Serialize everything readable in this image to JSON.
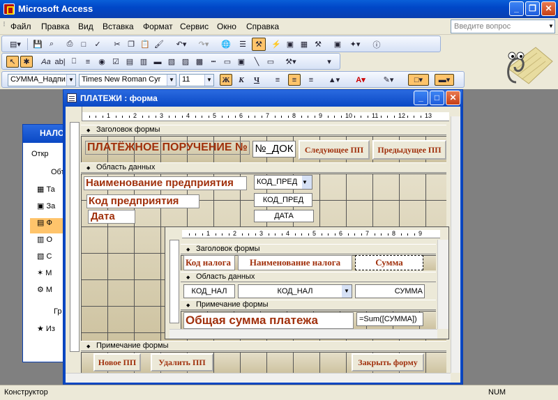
{
  "app": {
    "title": "Microsoft Access"
  },
  "menu": [
    "Файл",
    "Правка",
    "Вид",
    "Вставка",
    "Формат",
    "Сервис",
    "Окно",
    "Справка"
  ],
  "help_box": {
    "placeholder": "Введите вопрос"
  },
  "format_bar": {
    "object": "СУММА_Надпи",
    "font": "Times New Roman Cyr",
    "size": "11"
  },
  "db_window": {
    "title": "НАЛО",
    "open": "Откр",
    "objects_label": "Объ",
    "groups_label": "Гр",
    "items": [
      "Та",
      "За",
      "Ф",
      "О",
      "С",
      "М",
      "М",
      "Из"
    ]
  },
  "form_window": {
    "title": "ПЛАТЕЖИ : форма"
  },
  "ruler_ticks": [
    "1",
    "2",
    "3",
    "4",
    "5",
    "6",
    "7",
    "8",
    "9",
    "10",
    "11",
    "12",
    "13"
  ],
  "subruler_ticks": [
    "1",
    "2",
    "3",
    "4",
    "5",
    "6",
    "7",
    "8",
    "9"
  ],
  "bands": {
    "header": "Заголовок формы",
    "detail": "Область данных",
    "footer": "Примечание формы"
  },
  "header_section": {
    "title_label": "ПЛАТЁЖНОЕ ПОРУЧЕНИЕ №",
    "doc_field": "№_ДОК",
    "next_button": "Следующее ПП",
    "prev_button": "Предыдущее ПП"
  },
  "detail_section": {
    "company_name_label": "Наименование предприятия",
    "company_code_combo": "КОД_ПРЕД",
    "company_code_label": "Код  предприятия",
    "company_code_field": "КОД_ПРЕД",
    "date_label": "Дата",
    "date_field": "ДАТА"
  },
  "subform": {
    "header_band": "Заголовок формы",
    "detail_band": "Область данных",
    "footer_band": "Примечание формы",
    "col_code": "Код налога",
    "col_name": "Наименование налога",
    "col_sum": "Сумма",
    "field_code": "КОД_НАЛ",
    "field_name_combo": "КОД_НАЛ",
    "field_sum": "СУММА",
    "total_label": "Общая сумма платежа",
    "total_field": "=Sum([СУММА])"
  },
  "footer_section": {
    "new_button": "Новое ПП",
    "delete_button": "Удалить ПП",
    "close_button": "Закрыть форму"
  },
  "status": {
    "mode": "Конструктор",
    "num": "NUM"
  }
}
